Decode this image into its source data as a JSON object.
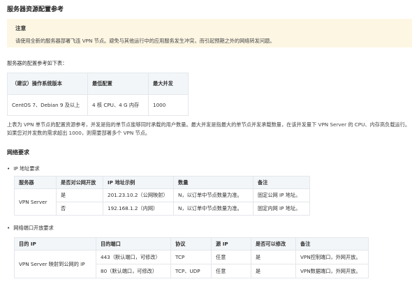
{
  "title": "服务器资源配置参考",
  "notice": {
    "title": "注意",
    "text": "请使用全新的服务器部署飞连 VPN 节点。避免与其他运行中的应用服务发生冲突，而引起预期之外的网络转发问题。"
  },
  "config_intro": "服务器的配置参考如下表：",
  "config_table": {
    "headers": [
      "（建议）操作系统版本",
      "最低配置",
      "最大并发"
    ],
    "rows": [
      [
        "CentOS 7、Debian 9 及以上",
        "4 核 CPU、4 G 内存",
        "1000"
      ]
    ]
  },
  "config_desc": "上表为 VPN 单节点的配置资源参考，并发是指的单节点能够同时承载的用户数量。最大并发是指最大的单节点并发承载数量，在该并发量下 VPN Server 的 CPU、内存高负载运行。如果您对并发数的需求超出 1000，则需要部署多个 VPN 节点。",
  "network_title": "网络要求",
  "ip_section": {
    "label": "IP 地址要求",
    "headers": [
      "服务器",
      "是否对公网开放",
      "IP 地址示例",
      "数量",
      "备注"
    ],
    "server": "VPN Server",
    "rows": [
      [
        "是",
        "201.23.10.2（公网映射）",
        "N，以订单中节点数量为准。",
        "固定公网 IP 地址。"
      ],
      [
        "否",
        "192.168.1.2（内网）",
        "N，以订单中节点数量为准。",
        "固定内网 IP 地址。"
      ]
    ]
  },
  "port_section": {
    "label": "网络端口开放要求",
    "headers": [
      "目的 IP",
      "目的端口",
      "协议",
      "源 IP",
      "是否可以修改",
      "备注"
    ],
    "dest": "VPN Server 映射到公网的 IP",
    "rows": [
      [
        "443（默认端口，可修改）",
        "TCP",
        "任意",
        "是",
        "VPN控制端口，外网开放。"
      ],
      [
        "80（默认端口，可修改）",
        "TCP、UDP",
        "任意",
        "是",
        "VPN数据端口，外网开放。"
      ]
    ]
  }
}
